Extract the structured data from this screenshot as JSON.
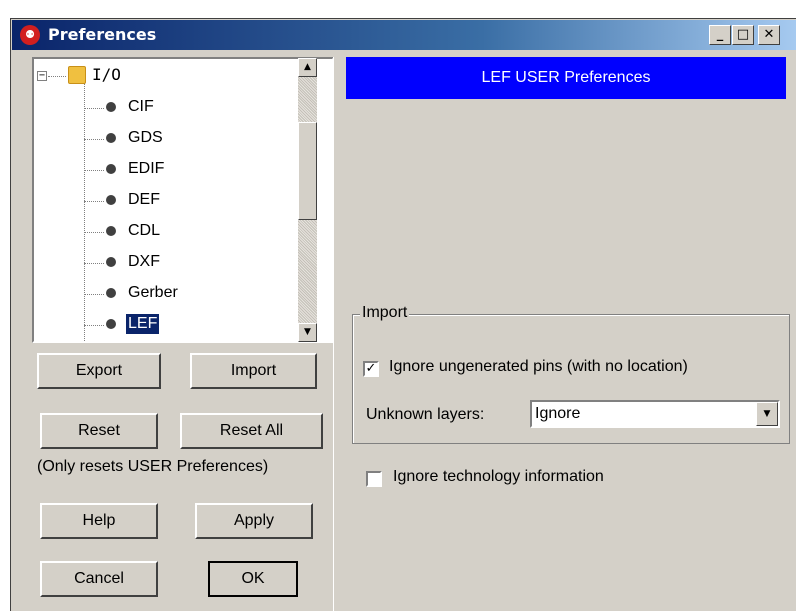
{
  "window": {
    "title": "Preferences",
    "app_icon": "app-logo-icon",
    "controls": {
      "minimize": "_",
      "maximize": "□",
      "close": "✕"
    }
  },
  "tree": {
    "expander": "−",
    "folder": {
      "label": "I/O",
      "icon": "folder-icon"
    },
    "items": [
      {
        "label": "CIF",
        "selected": false
      },
      {
        "label": "GDS",
        "selected": false
      },
      {
        "label": "EDIF",
        "selected": false
      },
      {
        "label": "DEF",
        "selected": false
      },
      {
        "label": "CDL",
        "selected": false
      },
      {
        "label": "DXF",
        "selected": false
      },
      {
        "label": "Gerber",
        "selected": false
      },
      {
        "label": "LEF",
        "selected": true
      }
    ],
    "scroll_up": "▲",
    "scroll_down": "▼"
  },
  "buttons": {
    "export": "Export",
    "import": "Import",
    "reset": "Reset",
    "reset_all": "Reset All",
    "help": "Help",
    "apply": "Apply",
    "cancel": "Cancel",
    "ok": "OK"
  },
  "reset_note": "(Only resets USER Preferences)",
  "panel": {
    "header": "LEF USER Preferences",
    "import_group": {
      "legend": "Import",
      "ignore_ungenerated_pins": {
        "label": "Ignore ungenerated pins (with no location)",
        "checked": true,
        "check_glyph": "✓"
      },
      "unknown_layers": {
        "label": "Unknown layers:",
        "value": "Ignore",
        "arrow": "▼"
      }
    },
    "ignore_technology": {
      "label": "Ignore technology information",
      "checked": false
    }
  },
  "colors": {
    "title_bar": "#0a246a",
    "header_banner": "#0000ff",
    "selection": "#0a246a",
    "dialog_bg": "#d4d0c8"
  }
}
